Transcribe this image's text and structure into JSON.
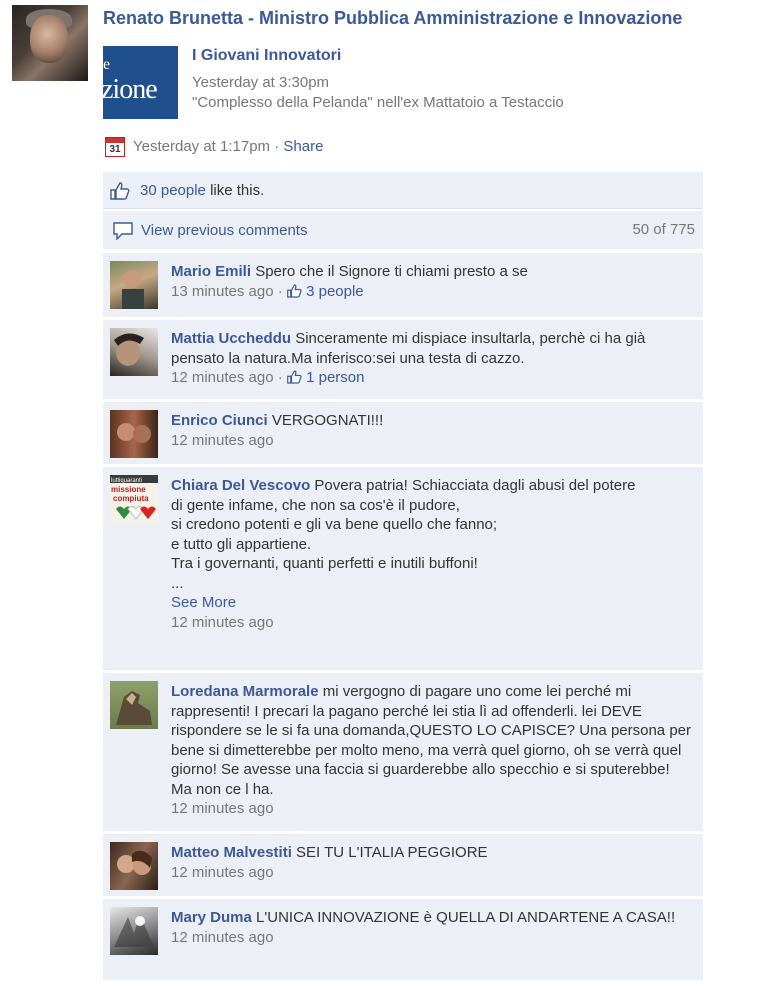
{
  "post": {
    "author": "Renato Brunetta - Ministro Pubblica Amministrazione e Innovazione",
    "event": {
      "title": "I Giovani Innovatori",
      "time": "Yesterday at 3:30pm",
      "place": "\"Complesso della Pelanda\" nell'ex Mattatoio a Testaccio",
      "thumb_text": "zione",
      "thumb_letter": "e"
    },
    "calendar_day": "31",
    "posted_time": "Yesterday at 1:17pm",
    "separator": "·",
    "share_label": "Share",
    "icons": {
      "calendar": "calendar-icon",
      "like": "thumbs-up-icon",
      "comment": "comment-bubble-icon"
    }
  },
  "likes_bar": {
    "people": "30 people",
    "suffix": " like this."
  },
  "comments_header": {
    "view_previous": "View previous comments",
    "count": "50 of 775"
  },
  "comments": [
    {
      "name": "Mario Emili",
      "text": "Spero che il Signore ti chiami presto a se",
      "time": "13 minutes ago",
      "likes": "3 people"
    },
    {
      "name": "Mattia Uccheddu",
      "text": "Sinceramente mi dispiace insultarla, perchè ci ha già pensato la natura.Ma inferisco:sei una testa di cazzo.",
      "time": "12 minutes ago",
      "likes": "1 person"
    },
    {
      "name": "Enrico Ciunci",
      "text": "VERGOGNATI!!!",
      "time": "12 minutes ago"
    },
    {
      "name": "Chiara Del Vescovo",
      "text_lines": [
        "Povera patria! Schiacciata dagli abusi del potere",
        "di gente infame, che non sa cos'è il pudore,",
        "si credono potenti e gli va bene quello che fanno;",
        "e tutto gli appartiene.",
        "Tra i governanti, quanti perfetti e inutili buffoni!",
        "..."
      ],
      "see_more": "See More",
      "time": "12 minutes ago",
      "avatar_text": [
        "luttiquaranti",
        "missione",
        "compiuta"
      ]
    },
    {
      "name": "Loredana Marmorale",
      "text": "mi vergogno di pagare uno come lei perché mi rappresenti! I precari la pagano perché lei stia lì ad offenderli. lei DEVE rispondere se le si fa una domanda,QUESTO LO CAPISCE? Una persona per bene si dimetterebbe per molto meno, ma verrà quel giorno, oh se verrà quel giorno! Se avesse una faccia si guarderebbe allo specchio e si sputerebbe! Ma non ce l ha.",
      "time": "12 minutes ago"
    },
    {
      "name": "Matteo Malvestiti",
      "text": "SEI TU L'ITALIA PEGGIORE",
      "time": "12 minutes ago"
    },
    {
      "name": "Mary Duma",
      "text": "L'UNICA INNOVAZIONE è QUELLA DI ANDARTENE A CASA!!",
      "time": "12 minutes ago"
    }
  ],
  "colors": {
    "link": "#3b5998",
    "muted": "#777777",
    "panel": "#eceff5"
  }
}
